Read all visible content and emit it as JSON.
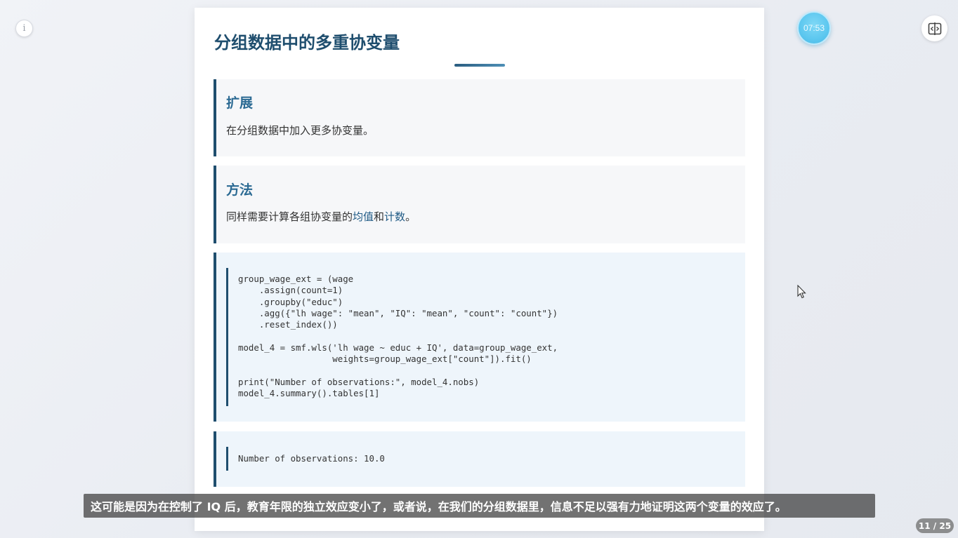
{
  "top_controls": {
    "info_glyph": "i",
    "timer": "07:53",
    "layout_icon": "split-view-icon"
  },
  "slide": {
    "title": "分组数据中的多重协变量",
    "sections": {
      "extend": {
        "heading": "扩展",
        "text": "在分组数据中加入更多协变量。"
      },
      "method": {
        "heading": "方法",
        "text_before": "同样需要计算各组协变量的",
        "term1": "均值",
        "joiner": "和",
        "term2": "计数",
        "text_after": "。"
      }
    },
    "code": "group_wage_ext = (wage\n    .assign(count=1)\n    .groupby(\"educ\")\n    .agg({\"lh wage\": \"mean\", \"IQ\": \"mean\", \"count\": \"count\"})\n    .reset_index())\n\nmodel_4 = smf.wls('lh wage ~ educ + IQ', data=group_wage_ext,\n                  weights=group_wage_ext[\"count\"]).fit()\n\nprint(\"Number of observations:\", model_4.nobs)\nmodel_4.summary().tables[1]",
    "output": "Number of observations: 10.0"
  },
  "caption": "这可能是因为在控制了 IQ 后，教育年限的独立效应变小了，或者说，在我们的分组数据里，信息不足以强有力地证明这两个变量的效应了。",
  "page_counter": "11 / 25",
  "colors": {
    "accent": "#1f4e6e",
    "heading": "#2b6a93",
    "timer": "#5cc7ef"
  }
}
